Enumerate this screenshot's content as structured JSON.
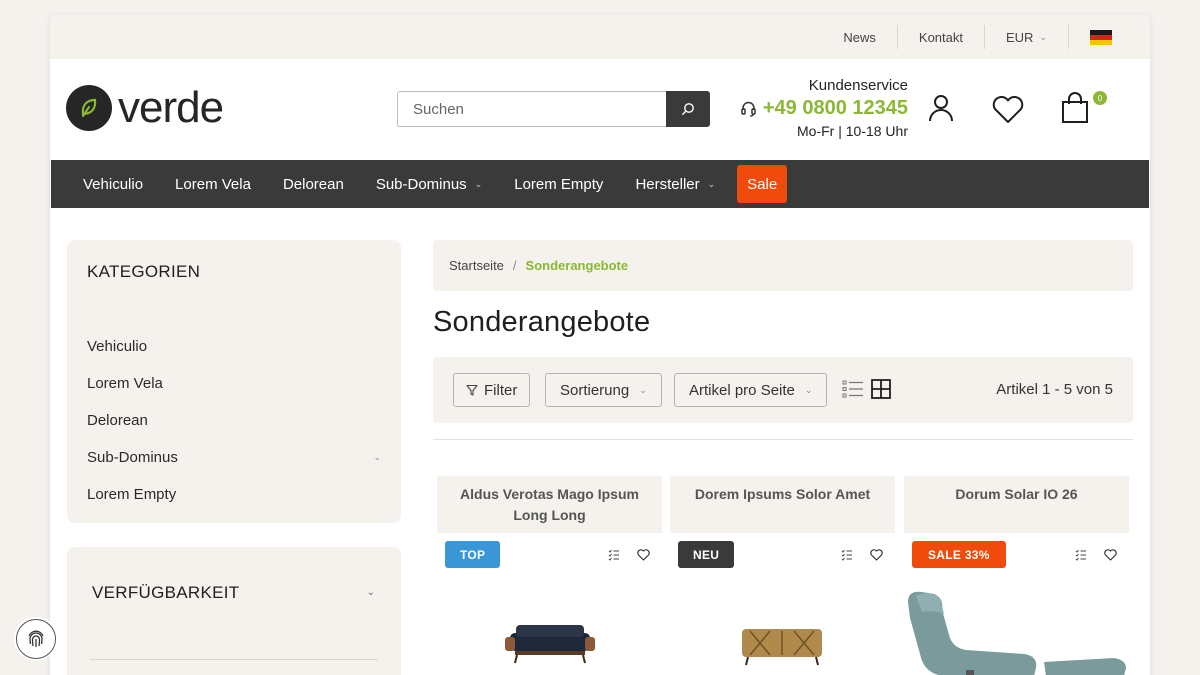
{
  "topbar": {
    "news": "News",
    "contact": "Kontakt",
    "currency": "EUR"
  },
  "brand": {
    "name": "verde"
  },
  "search": {
    "placeholder": "Suchen"
  },
  "service": {
    "label": "Kundenservice",
    "phone": "+49 0800 12345",
    "hours": "Mo-Fr | 10-18 Uhr"
  },
  "cart": {
    "count": "0"
  },
  "nav": {
    "items": [
      "Vehiculio",
      "Lorem Vela",
      "Delorean",
      "Sub-Dominus",
      "Lorem Empty",
      "Hersteller"
    ],
    "sale": "Sale"
  },
  "sidebar": {
    "categories_title": "KATEGORIEN",
    "categories": [
      "Vehiculio",
      "Lorem Vela",
      "Delorean",
      "Sub-Dominus",
      "Lorem Empty"
    ],
    "availability_title": "VERFÜGBARKEIT"
  },
  "breadcrumb": {
    "home": "Startseite",
    "current": "Sonderangebote"
  },
  "page_title": "Sonderangebote",
  "toolbar": {
    "filter": "Filter",
    "sort": "Sortierung",
    "per_page": "Artikel pro Seite",
    "count": "Artikel 1 - 5 von 5"
  },
  "products": [
    {
      "title": "Aldus Verotas Mago Ipsum Long Long",
      "badge": "TOP"
    },
    {
      "title": "Dorem Ipsums Solor Amet",
      "badge": "NEU"
    },
    {
      "title": "Dorum Solar IO 26",
      "badge": "SALE 33%"
    }
  ],
  "colors": {
    "accent_green": "#8ab833",
    "nav_dark": "#3a3a3a",
    "sale_orange": "#f04a0c",
    "badge_blue": "#3a96d4",
    "surface_beige": "#f5f2ee"
  }
}
